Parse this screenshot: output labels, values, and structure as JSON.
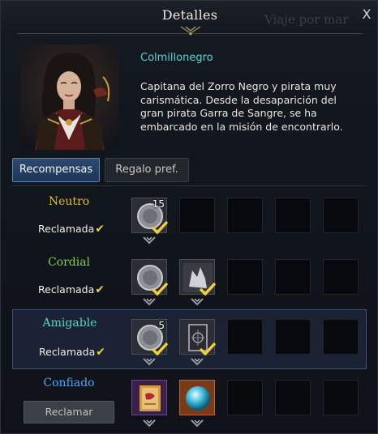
{
  "window": {
    "title": "Detalles",
    "ghost_title": "Viaje por mar",
    "close_label": "X"
  },
  "npc": {
    "name": "Colmillonegro",
    "description": "Capitana del Zorro Negro y pirata muy carismática. Desde la desaparición del gran pirata Garra de Sangre, se ha embarcado en la misión de encontrarlo."
  },
  "tabs": [
    {
      "label": "Recompensas",
      "active": true
    },
    {
      "label": "Regalo pref.",
      "active": false
    }
  ],
  "tiers": [
    {
      "name": "Neutro",
      "color": "#e6b93a",
      "status": "Reclamada",
      "rewards": [
        {
          "icon": "silver-coin-icon",
          "qty": "15",
          "claimed": true
        }
      ]
    },
    {
      "name": "Cordial",
      "color": "#7fd23a",
      "status": "Reclamada",
      "rewards": [
        {
          "icon": "silver-coin-icon",
          "qty": "",
          "claimed": true
        },
        {
          "icon": "wolf-emblem-icon",
          "qty": "",
          "claimed": true
        }
      ]
    },
    {
      "name": "Amigable",
      "color": "#57d6c8",
      "status": "Reclamada",
      "rewards": [
        {
          "icon": "silver-coin-icon",
          "qty": "5",
          "claimed": true
        },
        {
          "icon": "card-icon",
          "qty": "",
          "claimed": true
        }
      ]
    },
    {
      "name": "Confiado",
      "color": "#4ea8ee",
      "status": "",
      "button": "Reclamar",
      "rewards": [
        {
          "icon": "scroll-map-icon",
          "qty": "",
          "claimed": false
        },
        {
          "icon": "crystal-orb-icon",
          "qty": "",
          "claimed": false
        }
      ]
    }
  ]
}
